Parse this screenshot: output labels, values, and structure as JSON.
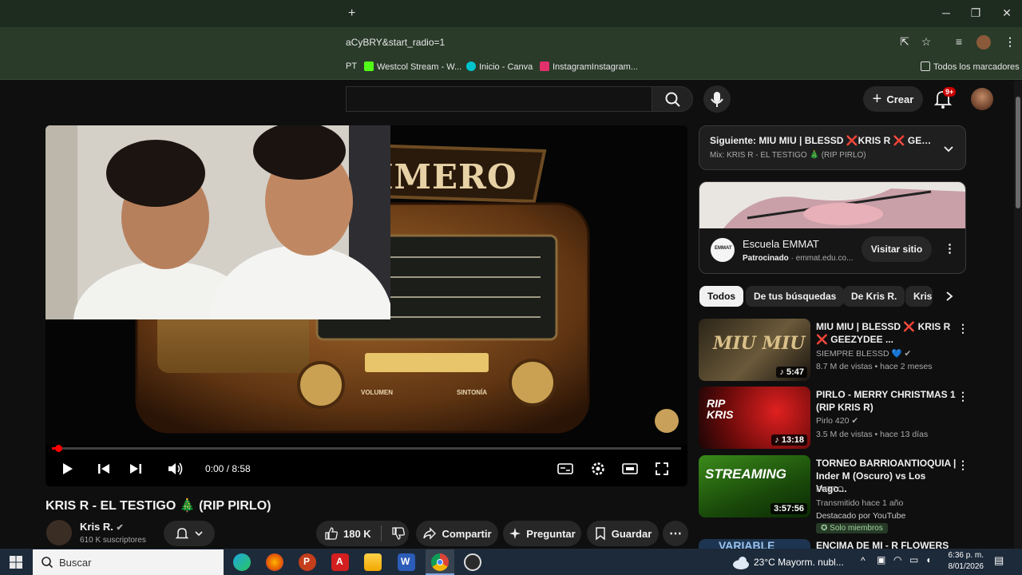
{
  "browser": {
    "new_tab": "+",
    "url": "aCyBRY&start_radio=1",
    "bookmarks": [
      {
        "label": "PT",
        "color": "#555555"
      },
      {
        "label": "Westcol Stream - W...",
        "color": "#53fc18"
      },
      {
        "label": "Inicio - Canva",
        "color": "#00c4cc"
      },
      {
        "label": "InstagramInstagram...",
        "color": "#e1306c"
      }
    ],
    "all_bookmarks": "Todos los marcadores",
    "avatar_initial": "",
    "minimize": "─",
    "restore": "❐",
    "close": "✕"
  },
  "yt_header": {
    "create_label": "Crear",
    "notif_count": "9+"
  },
  "player": {
    "time": "0:00 / 8:58",
    "progress": 0.01,
    "banner_text": "RIMERO",
    "radio_left_knob": "VOLUMEN",
    "radio_right_knob": "SINTONÍA"
  },
  "video": {
    "title": "KRIS R - EL TESTIGO 🎄 (RIP PIRLO)",
    "channel": "Kris R.",
    "subscribers": "610 K suscriptores",
    "likes": "180 K",
    "share": "Compartir",
    "ask": "Preguntar",
    "save": "Guardar"
  },
  "up_next": {
    "title": "Siguiente: MIU MIU | BLESSD ❌KRIS R ❌ GEEZY...",
    "subtitle": "Mix: KRIS R - EL TESTIGO 🎄 (RIP PIRLO)"
  },
  "ad": {
    "brand": "Escuela EMMAT",
    "sponsored": "Patrocinado",
    "domain": "emmat.edu.co...",
    "cta": "Visitar sitio",
    "logo_text": "EMMAT"
  },
  "chips": [
    "Todos",
    "De tus búsquedas",
    "De Kris R.",
    "Kris"
  ],
  "recommendations": [
    {
      "title_line1": "MIU MIU | BLESSD ❌ KRIS R",
      "title_line2": "❌ GEEZYDEE ...",
      "channel": "SIEMPRE BLESSD 💙",
      "meta": "8.7 M de vistas • hace 2 meses",
      "duration": "♪ 5:47",
      "thumb_text": "MIU MIU"
    },
    {
      "title_line1": "PIRLO - MERRY CHRISTMAS 1",
      "title_line2": "(RIP KRIS R)",
      "channel": "Pirlo 420",
      "meta": "3.5 M de vistas • hace 13 días",
      "duration": "♪ 13:18",
      "thumb_text": "RIP KRIS"
    },
    {
      "title_line1": "TORNEO BARRIOANTIOQUIA |",
      "title_line2": "Inder M (Oscuro) vs Los Vago...",
      "channel": "FUTTO",
      "meta": "Transmitido hace 1 año",
      "extra": "Destacado por YouTube",
      "badge": "Solo miembros",
      "duration": "3:57:56",
      "thumb_text": "STREAMING"
    },
    {
      "title_line1": "ENCIMA DE MI - R FLOWERS",
      "thumb_text": "VARIABLE"
    }
  ],
  "taskbar": {
    "search_placeholder": "Buscar",
    "weather": "23°C  Mayorm. nubl...",
    "time": "6:36 p. m.",
    "date": "8/01/2026"
  }
}
